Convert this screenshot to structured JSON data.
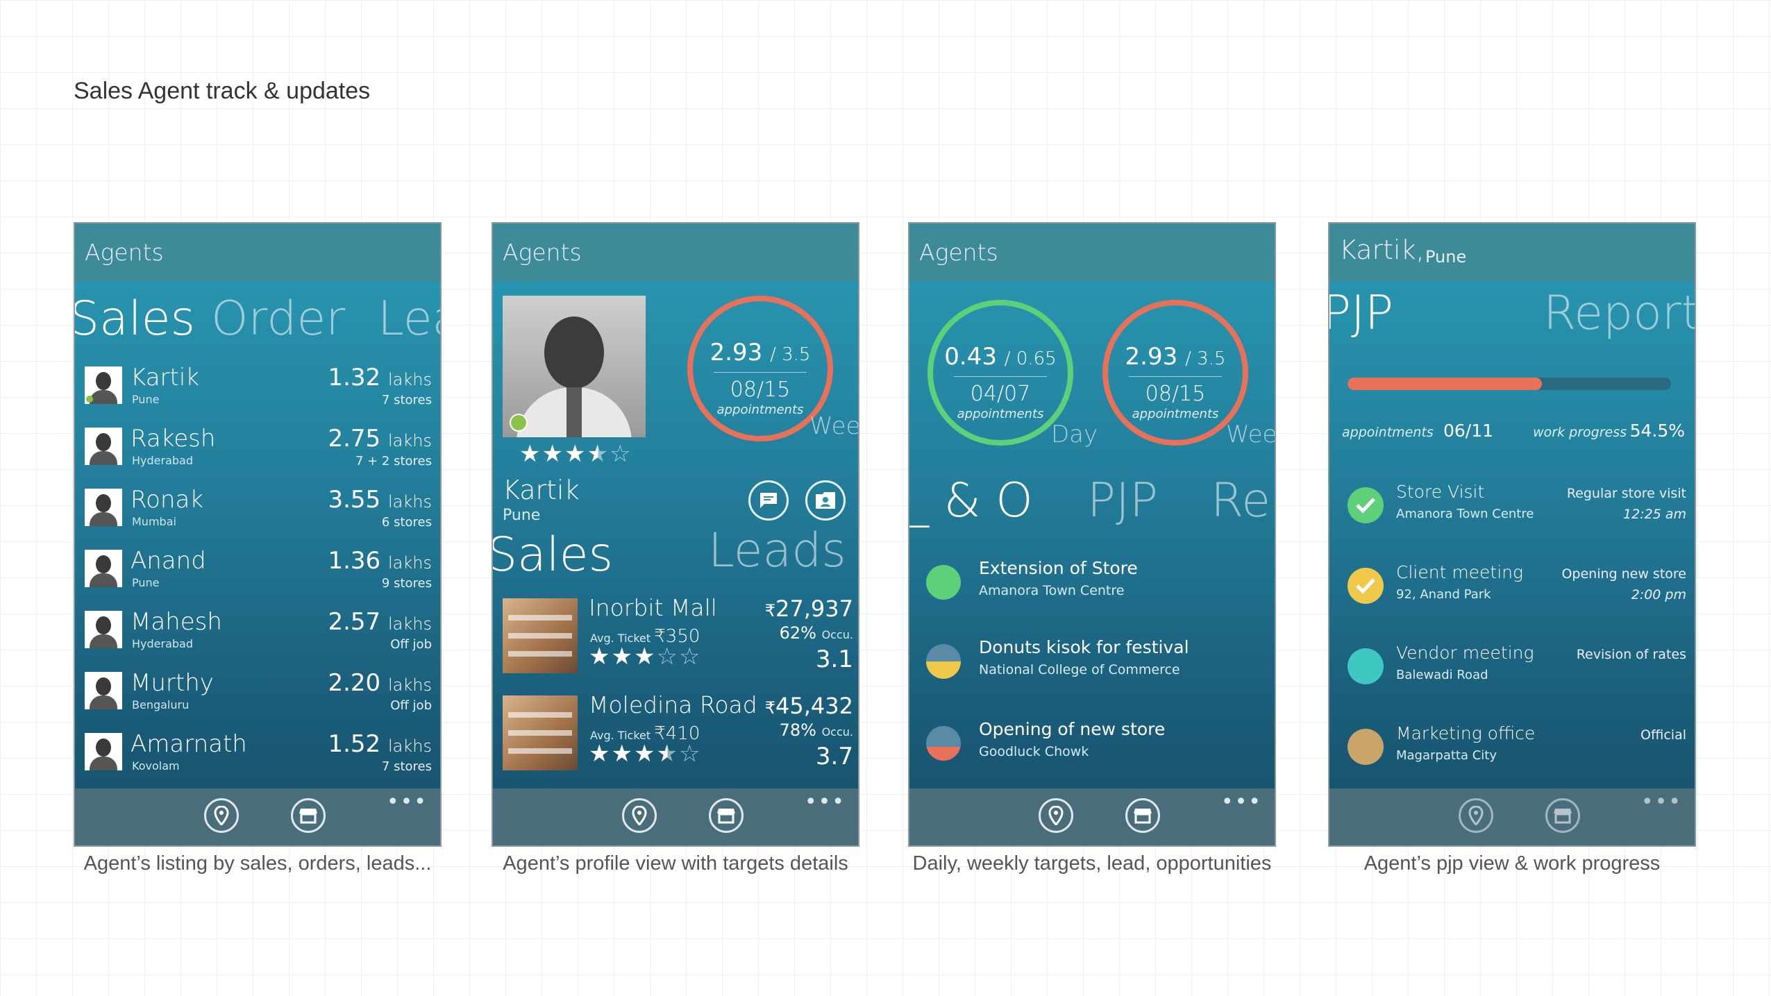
{
  "page_title": "Sales Agent track & updates",
  "captions": [
    "Agent’s listing by sales, orders, leads...",
    "Agent’s profile view with targets details",
    "Daily, weekly targets, lead, opportunities",
    "Agent’s pjp view & work progress"
  ],
  "common": {
    "header": "Agents",
    "more": "•••"
  },
  "screen1": {
    "tabs": [
      "Sales",
      "Order",
      "Lea"
    ],
    "unit": "lakhs",
    "agents": [
      {
        "name": "Kartik",
        "city": "Pune",
        "value": "1.32",
        "extra": "7 stores"
      },
      {
        "name": "Rakesh",
        "city": "Hyderabad",
        "value": "2.75",
        "extra": "7 + 2 stores"
      },
      {
        "name": "Ronak",
        "city": "Mumbai",
        "value": "3.55",
        "extra": "6 stores"
      },
      {
        "name": "Anand",
        "city": "Pune",
        "value": "1.36",
        "extra": "9 stores"
      },
      {
        "name": "Mahesh",
        "city": "Hyderabad",
        "value": "2.57",
        "extra": "Off job"
      },
      {
        "name": "Murthy",
        "city": "Bengaluru",
        "value": "2.20",
        "extra": "Off job"
      },
      {
        "name": "Amarnath",
        "city": "Kovolam",
        "value": "1.52",
        "extra": "7 stores"
      }
    ]
  },
  "screen2": {
    "name": "Kartik",
    "city": "Pune",
    "rating": 3.5,
    "ring": {
      "value": "2.93",
      "target": "/ 3.5",
      "count": "08/15",
      "label": "appointments",
      "period": "Week"
    },
    "tabs": [
      "Sales",
      "Leads &"
    ],
    "ticket_label": "Avg. Ticket",
    "occ_label": "Occu.",
    "currency": "₹",
    "stores": [
      {
        "name": "Inorbit Mall",
        "amount": "27,937",
        "ticket": "350",
        "occ": "62%",
        "score": "3.1",
        "rating": 3
      },
      {
        "name": "Moledina Road",
        "amount": "45,432",
        "ticket": "410",
        "occ": "78%",
        "score": "3.7",
        "rating": 3.5
      }
    ]
  },
  "screen3": {
    "rings": [
      {
        "value": "0.43",
        "target": "/ 0.65",
        "count": "04/07",
        "label": "appointments",
        "period": "Day",
        "color": "#5fd07a"
      },
      {
        "value": "2.93",
        "target": "/ 3.5",
        "count": "08/15",
        "label": "appointments",
        "period": "Week",
        "color": "#e9715a"
      }
    ],
    "tabs": [
      "_ & O",
      "PJP",
      "Rep"
    ],
    "leads": [
      {
        "title": "Extension of Store",
        "sub": "Amanora Town Centre"
      },
      {
        "title": "Donuts kisok for festival",
        "sub": "National College of Commerce"
      },
      {
        "title": "Opening of new store",
        "sub": "Goodluck Chowk"
      }
    ]
  },
  "screen4": {
    "name": "Kartik,",
    "city": "Pune",
    "tabs": [
      "PJP",
      "Reports"
    ],
    "progress": 0.6,
    "appointments_label": "appointments",
    "appointments_value": "06/11",
    "work_label": "work progress",
    "work_value": "54.5%",
    "items": [
      {
        "title": "Store Visit",
        "sub": "Amanora Town Centre",
        "note": "Regular store visit",
        "time": "12:25 am",
        "color": "#5fd07a",
        "check": true
      },
      {
        "title": "Client meeting",
        "sub": "92, Anand Park",
        "note": "Opening new store",
        "time": "2:00 pm",
        "color": "#f0c94a",
        "check": true
      },
      {
        "title": "Vendor meeting",
        "sub": "Balewadi Road",
        "note": "Revision of rates",
        "time": "",
        "color": "#3fc7c2",
        "check": false
      },
      {
        "title": "Marketing office",
        "sub": "Magarpatta City",
        "note": "Official",
        "time": "",
        "color": "#c9a56a",
        "check": false
      }
    ]
  }
}
